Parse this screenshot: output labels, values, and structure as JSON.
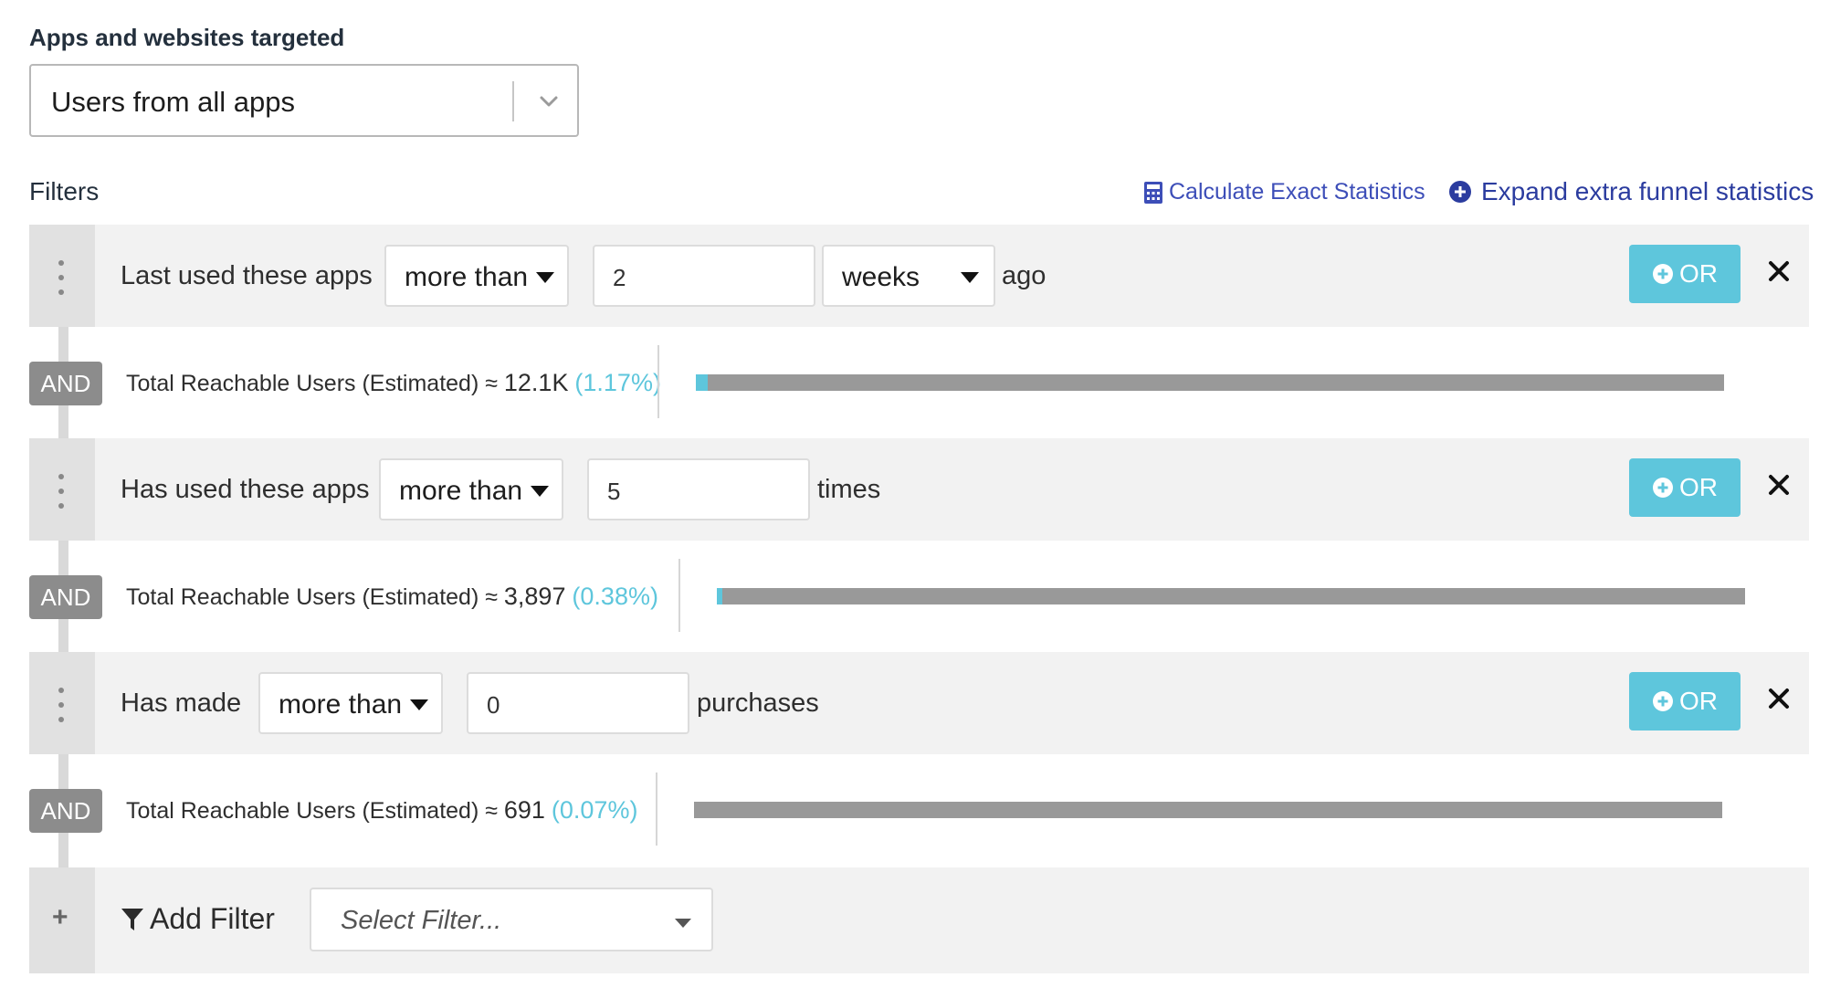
{
  "apps": {
    "title": "Apps and websites targeted",
    "selected": "Users from all apps"
  },
  "filters": {
    "title": "Filters",
    "calc_link": "Calculate Exact Statistics",
    "expand_link": "Expand extra funnel statistics",
    "rows": [
      {
        "label": "Last used these apps",
        "comparator": "more than",
        "value": "2",
        "unit": "weeks",
        "suffix": "ago",
        "or_label": "OR"
      },
      {
        "label": "Has used these apps",
        "comparator": "more than",
        "value": "5",
        "suffix": "times",
        "or_label": "OR"
      },
      {
        "label": "Has made",
        "comparator": "more than",
        "value": "0",
        "suffix": "purchases",
        "or_label": "OR"
      }
    ],
    "stats": [
      {
        "and_label": "AND",
        "text": "Total Reachable Users (Estimated) ≈",
        "count": "12.1K",
        "pct": "(1.17%)",
        "fill_fraction": 0.0117
      },
      {
        "and_label": "AND",
        "text": "Total Reachable Users (Estimated) ≈",
        "count": "3,897",
        "pct": "(0.38%)",
        "fill_fraction": 0.0038
      },
      {
        "and_label": "AND",
        "text": "Total Reachable Users (Estimated) ≈",
        "count": "691",
        "pct": "(0.07%)",
        "fill_fraction": 0.0007
      }
    ],
    "add": {
      "label": "Add Filter",
      "placeholder": "Select Filter..."
    }
  },
  "colors": {
    "accent": "#5ec6dc",
    "link": "#2b3c9f",
    "bar": "#999999",
    "and_badge": "#8c8c8c"
  },
  "icons": {
    "calc": "calculator-icon",
    "expand": "plus-circle-icon",
    "or": "plus-circle-icon",
    "close": "close-icon",
    "drag": "drag-handle-icon",
    "filter": "funnel-icon",
    "chevron": "chevron-down-icon"
  }
}
